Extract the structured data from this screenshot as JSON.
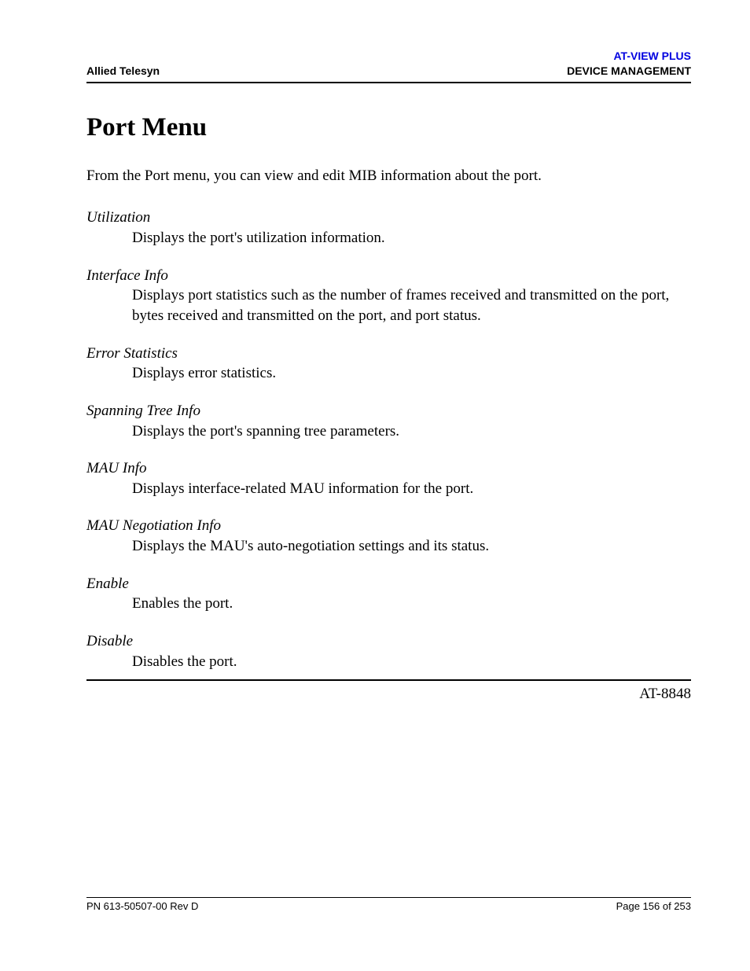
{
  "header": {
    "left": "Allied Telesyn",
    "right_top": "AT-VIEW PLUS",
    "right_bottom": "DEVICE MANAGEMENT"
  },
  "title": "Port Menu",
  "intro": "From the Port menu, you can view and edit MIB information about the port.",
  "entries": [
    {
      "term": "Utilization",
      "desc": "Displays the port's utilization information."
    },
    {
      "term": "Interface Info",
      "desc": "Displays port statistics such as the number of frames received and transmitted on the port, bytes received and transmitted on the port, and port status."
    },
    {
      "term": "Error Statistics",
      "desc": "Displays error statistics."
    },
    {
      "term": "Spanning Tree Info",
      "desc": "Displays the port's spanning tree parameters."
    },
    {
      "term": "MAU Info",
      "desc": "Displays interface-related MAU information for the port."
    },
    {
      "term": "MAU Negotiation Info",
      "desc": "Displays the MAU's auto-negotiation settings and its status."
    },
    {
      "term": "Enable",
      "desc": "Enables the port."
    },
    {
      "term": "Disable",
      "desc": "Disables the port."
    }
  ],
  "model": "AT-8848",
  "footer": {
    "left": "PN 613-50507-00 Rev D",
    "right": "Page 156 of 253"
  }
}
